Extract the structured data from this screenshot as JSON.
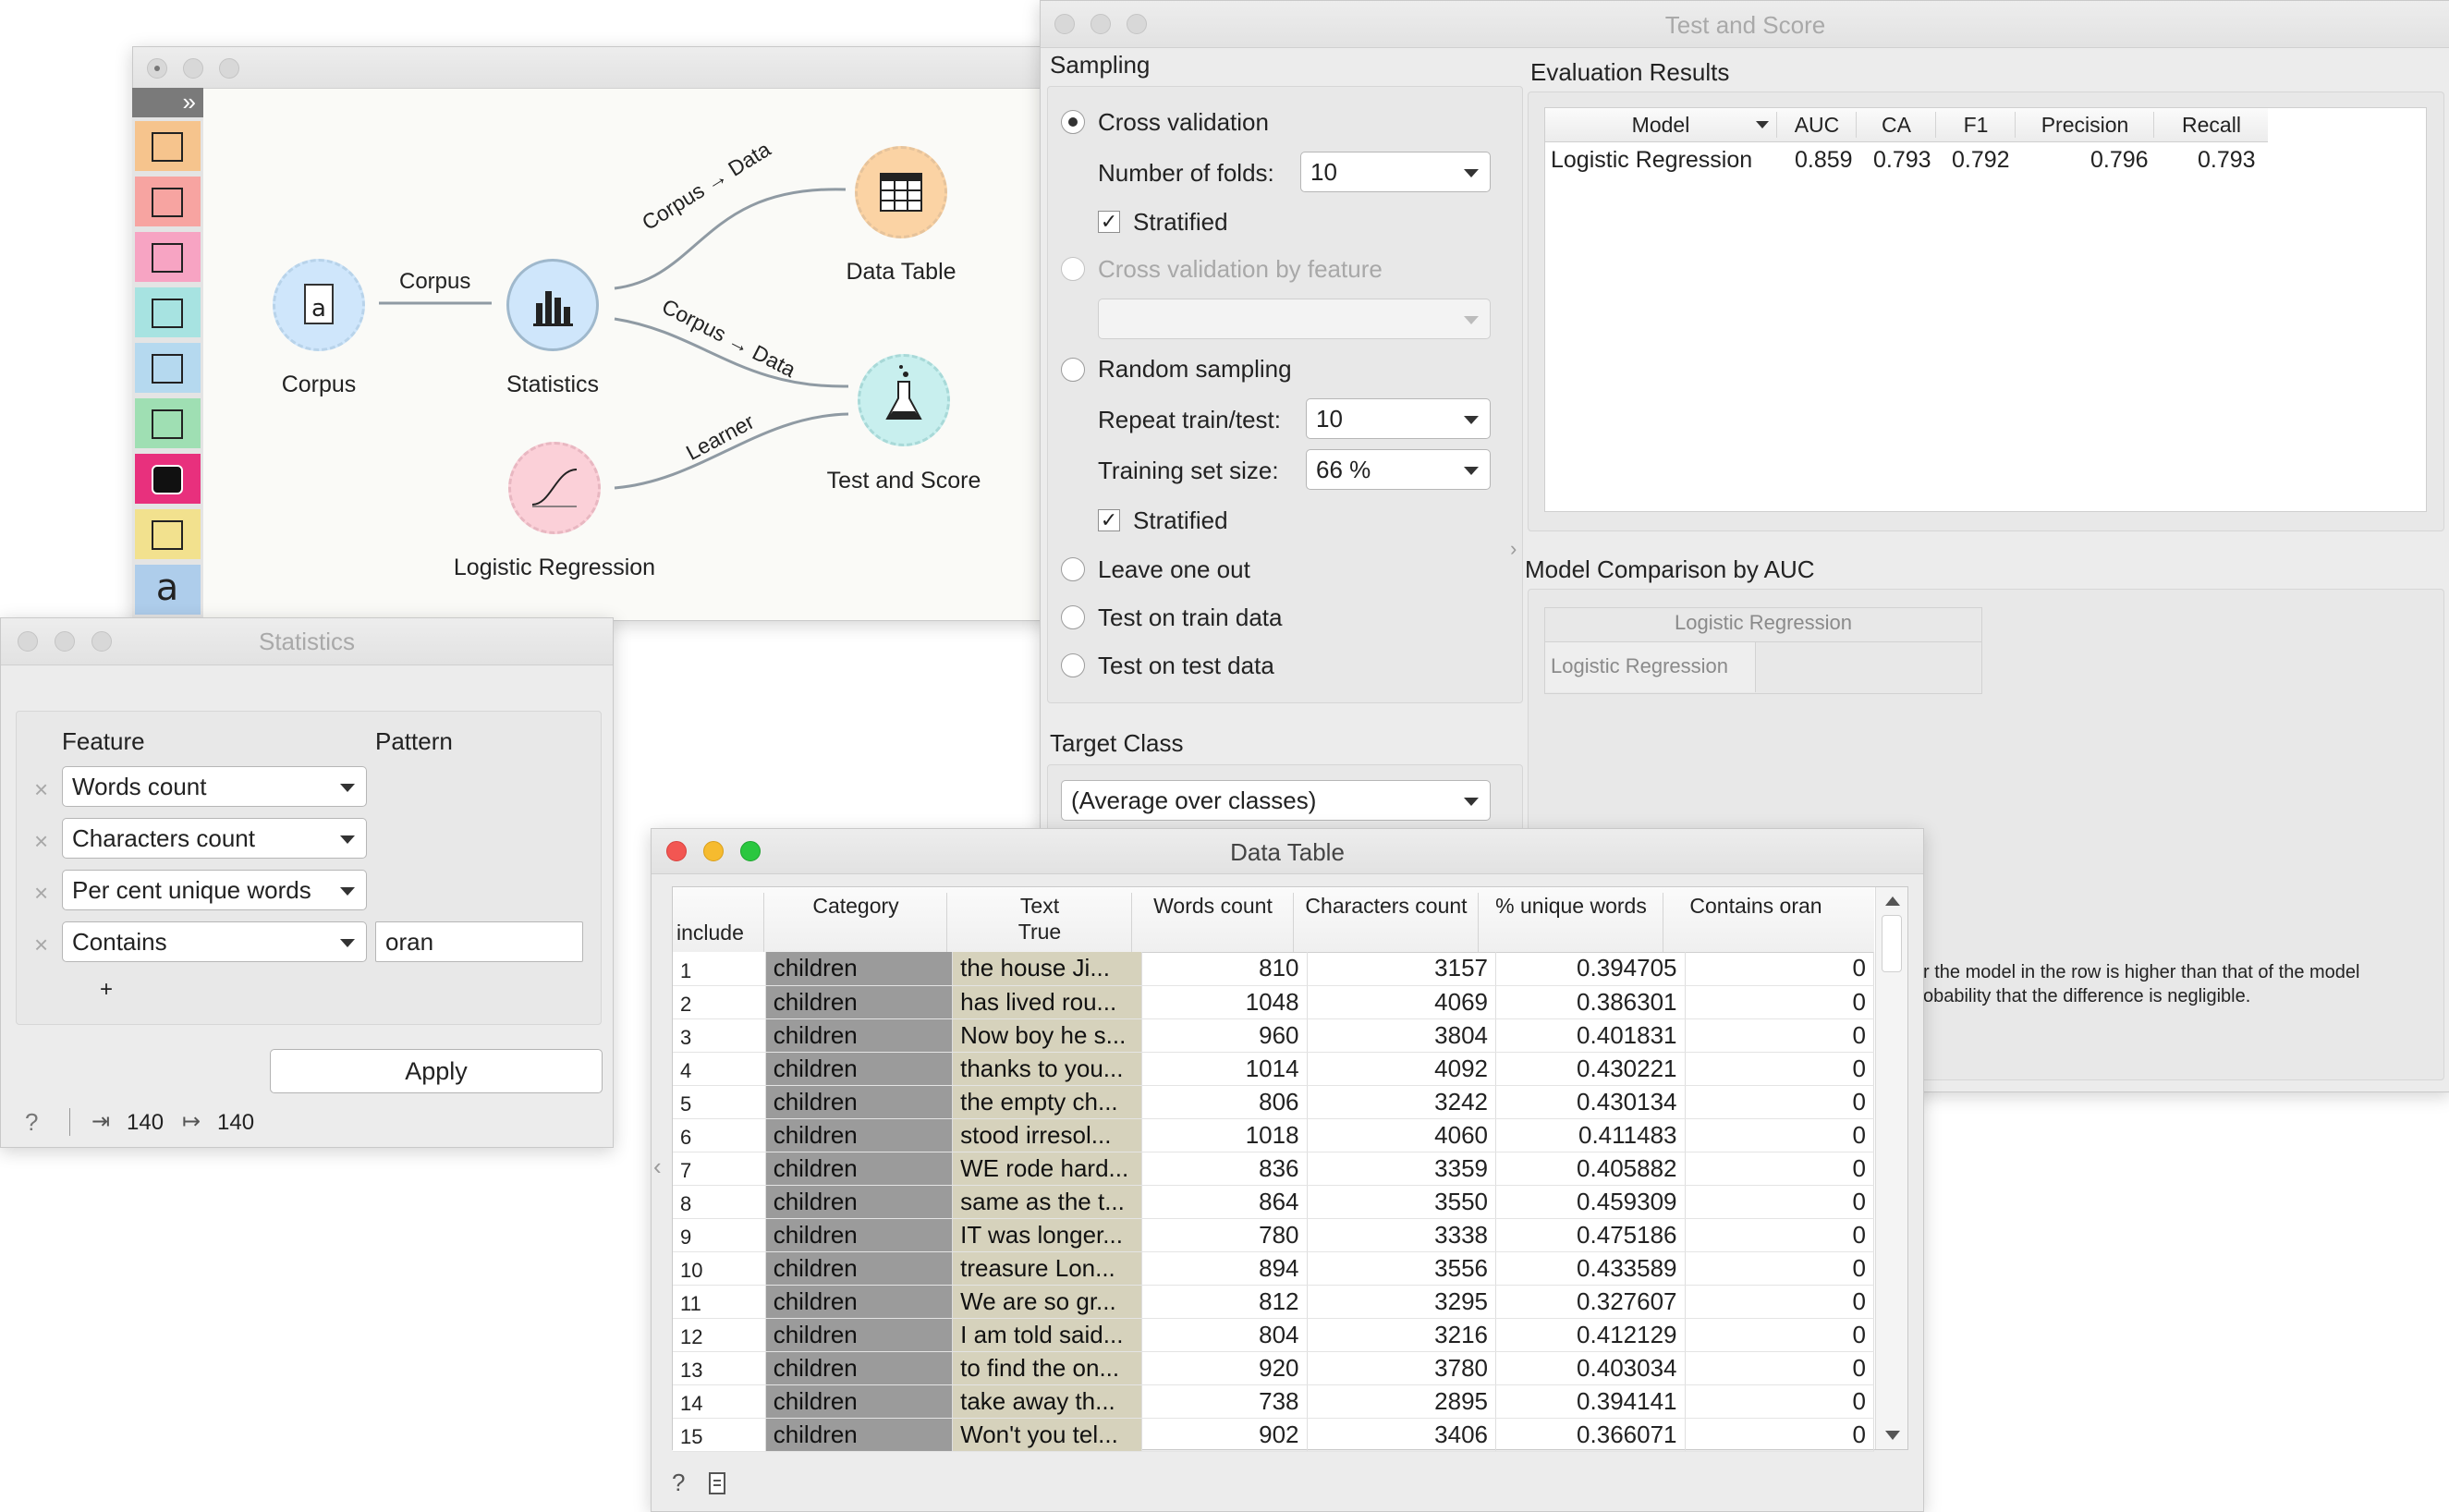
{
  "canvas": {
    "sidebar_toggle": "»",
    "sidebar_icons": [
      {
        "name": "table-icon",
        "color": "#f6c48d"
      },
      {
        "name": "scatter-plot-icon",
        "color": "#f7a4a1"
      },
      {
        "name": "tree-icon",
        "color": "#f7a4c3"
      },
      {
        "name": "test-score-icon",
        "color": "#a7e3e1"
      },
      {
        "name": "cluster-icon",
        "color": "#b5d9ef"
      },
      {
        "name": "digger-icon",
        "color": "#9fdfb3"
      },
      {
        "name": "camera-icon",
        "color": "#e8307d"
      },
      {
        "name": "image-icon",
        "color": "#f2e18e"
      },
      {
        "name": "text-a-icon",
        "color": "#aecdeb"
      }
    ],
    "nodes": {
      "corpus": "Corpus",
      "statistics": "Statistics",
      "data_table": "Data Table",
      "test_score": "Test and Score",
      "logreg": "Logistic Regression"
    },
    "links": {
      "corpus_stats": "Corpus",
      "stats_table": "Corpus → Data",
      "stats_test": "Corpus → Data",
      "logreg_test": "Learner"
    }
  },
  "statistics_window": {
    "title": "Statistics",
    "feature_header": "Feature",
    "pattern_header": "Pattern",
    "rows": [
      {
        "feature": "Words count",
        "pattern": ""
      },
      {
        "feature": "Characters count",
        "pattern": ""
      },
      {
        "feature": "Per cent unique words",
        "pattern": ""
      },
      {
        "feature": "Contains",
        "pattern": "oran"
      }
    ],
    "remove_glyph": "×",
    "add_glyph": "+",
    "apply_label": "Apply",
    "help_glyph": "?",
    "input_count": "140",
    "output_count": "140"
  },
  "test_window": {
    "title": "Test and Score",
    "sampling_label": "Sampling",
    "cross_validation": "Cross validation",
    "folds_label": "Number of folds:",
    "folds_value": "10",
    "stratified": "Stratified",
    "cv_by_feature": "Cross validation by feature",
    "random_sampling": "Random sampling",
    "repeat_label": "Repeat train/test:",
    "repeat_value": "10",
    "train_size_label": "Training set size:",
    "train_size_value": "66 %",
    "stratified2": "Stratified",
    "leave_one_out": "Leave one out",
    "test_train": "Test on train data",
    "test_test": "Test on test data",
    "target_label": "Target Class",
    "target_value": "(Average over classes)",
    "eval_label": "Evaluation Results",
    "eval_headers": [
      "Model",
      "AUC",
      "CA",
      "F1",
      "Precision",
      "Recall"
    ],
    "eval_row": [
      "Logistic Regression",
      "0.859",
      "0.793",
      "0.792",
      "0.796",
      "0.793"
    ],
    "comparison_label": "Model Comparison by AUC",
    "comparison_col": "Logistic Regression",
    "comparison_row": "Logistic Regression",
    "note_line1": "r the model in the row is higher than that of the model",
    "note_line2": "obability that the difference is negligible."
  },
  "data_table": {
    "title": "Data Table",
    "headers": {
      "include": "include",
      "category": "Category",
      "text1": "Text",
      "text2": "True",
      "words": "Words count",
      "chars": "Characters count",
      "unique": "% unique words",
      "contains": "Contains oran"
    },
    "rows": [
      [
        "1",
        "children",
        "the house Ji...",
        "810",
        "3157",
        "0.394705",
        "0"
      ],
      [
        "2",
        "children",
        "has lived rou...",
        "1048",
        "4069",
        "0.386301",
        "0"
      ],
      [
        "3",
        "children",
        "Now boy he s...",
        "960",
        "3804",
        "0.401831",
        "0"
      ],
      [
        "4",
        "children",
        "thanks to you...",
        "1014",
        "4092",
        "0.430221",
        "0"
      ],
      [
        "5",
        "children",
        "the empty ch...",
        "806",
        "3242",
        "0.430134",
        "0"
      ],
      [
        "6",
        "children",
        "stood irresol...",
        "1018",
        "4060",
        "0.411483",
        "0"
      ],
      [
        "7",
        "children",
        "WE rode hard...",
        "836",
        "3359",
        "0.405882",
        "0"
      ],
      [
        "8",
        "children",
        "same as the t...",
        "864",
        "3550",
        "0.459309",
        "0"
      ],
      [
        "9",
        "children",
        "IT was longer...",
        "780",
        "3338",
        "0.475186",
        "0"
      ],
      [
        "10",
        "children",
        "treasure Lon...",
        "894",
        "3556",
        "0.433589",
        "0"
      ],
      [
        "11",
        "children",
        "We are so gr...",
        "812",
        "3295",
        "0.327607",
        "0"
      ],
      [
        "12",
        "children",
        "I am told said...",
        "804",
        "3216",
        "0.412129",
        "0"
      ],
      [
        "13",
        "children",
        "to find the on...",
        "920",
        "3780",
        "0.403034",
        "0"
      ],
      [
        "14",
        "children",
        "take away th...",
        "738",
        "2895",
        "0.394141",
        "0"
      ],
      [
        "15",
        "children",
        "Won't you tel...",
        "902",
        "3406",
        "0.366071",
        "0"
      ]
    ],
    "help_glyph": "?"
  }
}
